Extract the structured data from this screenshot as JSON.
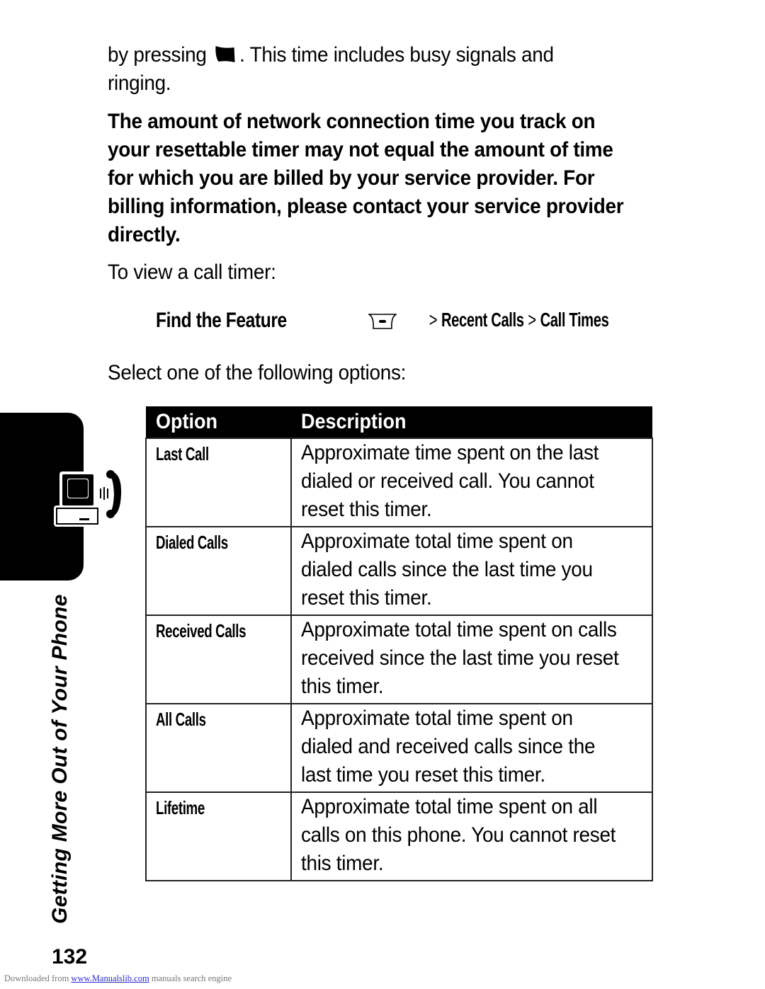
{
  "intro": {
    "before_icon": "by pressing",
    "icon": "end-key-icon",
    "after_icon": ". This time includes busy signals and ringing."
  },
  "warning": "The amount of network connection time you track on your resettable timer may not equal the amount of time for which you are billed by your service provider. For billing information, please contact your service provider directly.",
  "view_timer": "To view a call timer:",
  "find_feature": {
    "label": "Find the Feature",
    "key_icon": "menu-key-icon",
    "separator": ">",
    "path": [
      "Recent Calls",
      "Call Times"
    ]
  },
  "select_prompt": "Select one of the following options:",
  "table": {
    "headers": {
      "option": "Option",
      "description": "Description"
    },
    "rows": [
      {
        "option": "Last Call",
        "description": "Approximate time spent on the last dialed or received call. You cannot reset this timer."
      },
      {
        "option": "Dialed Calls",
        "description": "Approximate total time spent on dialed calls since the last time you reset this timer."
      },
      {
        "option": "Received Calls",
        "description": "Approximate total time spent on calls received since the last time you reset this timer."
      },
      {
        "option": "All Calls",
        "description": "Approximate total time spent on dialed and received calls since the last time you reset this timer."
      },
      {
        "option": "Lifetime",
        "description": "Approximate total time spent on all calls on this phone. You cannot reset this timer."
      }
    ]
  },
  "side": {
    "section_title": "Getting More Out of Your Phone",
    "icon": "computer-phone-icon"
  },
  "page_number": "132",
  "footer": {
    "prefix": "Downloaded from",
    "link": "www.Manualslib.com",
    "suffix": "manuals search engine"
  }
}
